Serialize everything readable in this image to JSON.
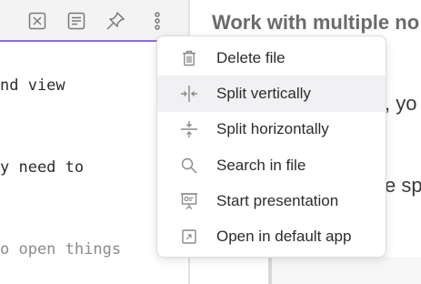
{
  "header_icons": [
    "close-square-icon",
    "reading-view-icon",
    "pin-icon",
    "more-options-icon"
  ],
  "editor": {
    "lines": [
      "nd view",
      "y need to",
      "o open things"
    ]
  },
  "right_pane": {
    "title": "Work with multiple no",
    "fragment_1": ", yo",
    "fragment_2": "e sp"
  },
  "context_menu": {
    "items": [
      {
        "label": "Delete file",
        "icon": "trash-icon"
      },
      {
        "label": "Split vertically",
        "icon": "split-vertical-icon"
      },
      {
        "label": "Split horizontally",
        "icon": "split-horizontal-icon"
      },
      {
        "label": "Search in file",
        "icon": "search-icon"
      },
      {
        "label": "Start presentation",
        "icon": "presentation-icon"
      },
      {
        "label": "Open in default app",
        "icon": "open-external-icon"
      }
    ],
    "hovered_index": 1
  },
  "colors": {
    "accent": "#8b6cd9",
    "menu_hover": "#f1f1f3",
    "icon": "#8a8a8a"
  }
}
